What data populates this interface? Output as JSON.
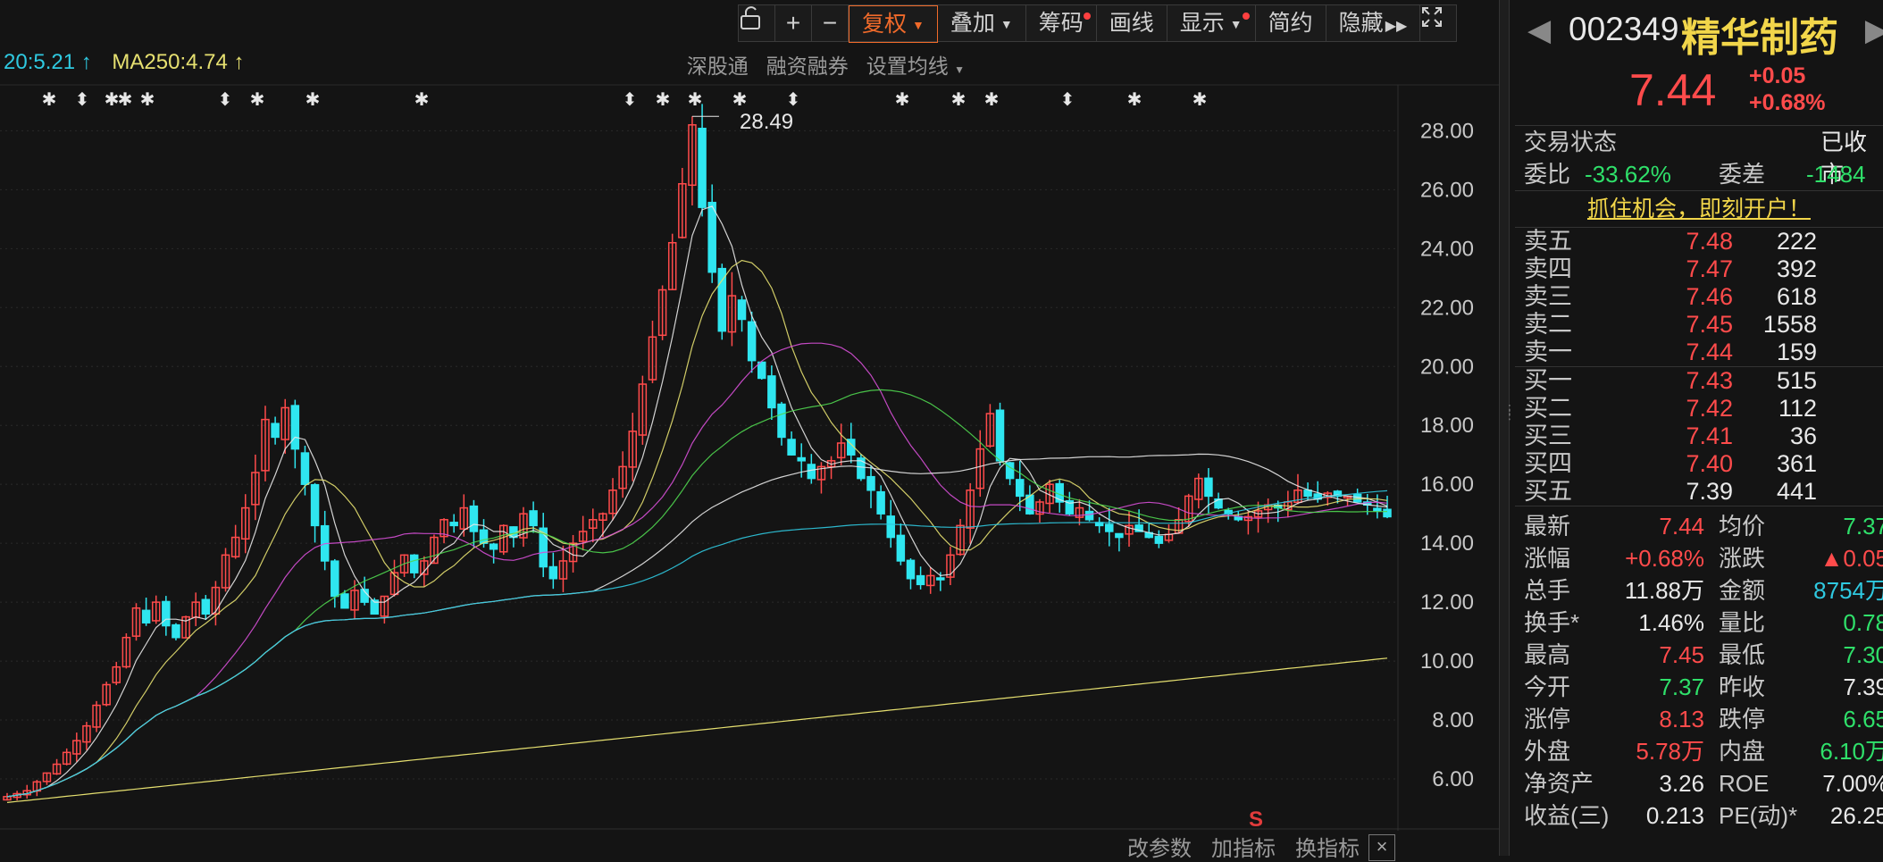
{
  "toolbar": {
    "items": [
      "复权",
      "叠加",
      "筹码",
      "画线",
      "显示",
      "简约",
      "隐藏"
    ]
  },
  "ma_legend": {
    "item_a": "20:5.21 ↑",
    "item_b": "MA250:4.74 ↑"
  },
  "quick_links": [
    "深股通",
    "融资融券",
    "设置均线"
  ],
  "peak_label": "28.49",
  "bottom_bar": [
    "改参数",
    "加指标",
    "换指标"
  ],
  "s_marker": "S",
  "colors": {
    "up": "#ff4b4b",
    "down": "#2fe6f0",
    "accent": "#f06a2a"
  },
  "chart_data": {
    "type": "candlestick",
    "y_ticks": [
      "28.00",
      "26.00",
      "24.00",
      "22.00",
      "20.00",
      "18.00",
      "16.00",
      "14.00",
      "12.00",
      "10.00",
      "8.00",
      "6.00"
    ],
    "ylim": [
      5.0,
      28.8
    ],
    "max_value": 28.49,
    "closes": [
      5.4,
      5.5,
      5.6,
      5.9,
      6.2,
      6.5,
      6.9,
      7.3,
      7.8,
      8.5,
      9.2,
      9.8,
      10.8,
      11.8,
      11.3,
      12.0,
      11.2,
      10.8,
      11.5,
      12.0,
      11.6,
      12.5,
      13.6,
      14.2,
      15.2,
      16.4,
      18.2,
      17.6,
      18.6,
      17.2,
      16.0,
      14.6,
      13.4,
      12.2,
      11.8,
      12.4,
      12.0,
      11.6,
      12.2,
      13.0,
      13.6,
      13.0,
      13.4,
      14.2,
      14.8,
      14.6,
      15.2,
      14.4,
      14.0,
      13.8,
      14.6,
      14.2,
      15.0,
      14.6,
      13.2,
      12.8,
      13.4,
      14.0,
      14.4,
      14.8,
      15.0,
      15.8,
      16.6,
      17.8,
      19.4,
      21.0,
      22.6,
      24.2,
      26.2,
      28.2,
      25.4,
      23.2,
      21.2,
      22.4,
      21.6,
      20.2,
      19.6,
      18.6,
      17.6,
      17.0,
      16.8,
      16.2,
      16.6,
      16.8,
      17.4,
      17.0,
      16.2,
      15.8,
      15.0,
      14.2,
      13.4,
      12.8,
      12.6,
      12.9,
      12.8,
      13.6,
      14.6,
      15.8,
      17.2,
      18.4,
      16.8,
      16.2,
      15.6,
      15.0,
      15.4,
      16.0,
      15.4,
      15.0,
      15.2,
      14.8,
      14.6,
      14.4,
      14.2,
      14.6,
      14.4,
      14.2,
      14.0,
      14.3,
      14.8,
      15.6,
      16.2,
      15.6,
      15.2,
      15.0,
      14.8,
      14.9,
      15.1,
      15.3,
      15.2,
      15.4,
      15.8,
      15.6,
      15.5,
      15.7,
      15.6,
      15.6,
      15.4,
      15.3,
      15.1,
      14.9
    ]
  },
  "stock": {
    "code": "002349",
    "name": "精华制药",
    "price": "7.44",
    "change": "+0.05",
    "change_pct": "+0.68%"
  },
  "status": {
    "label": "交易状态",
    "value": "已收市"
  },
  "ratio": {
    "wb_label": "委比",
    "wb_value": "-33.62%",
    "wc_label": "委差",
    "wc_value": "-1484"
  },
  "promo": "抓住机会，即刻开户！",
  "sells": [
    {
      "label": "卖五",
      "price": "7.48",
      "vol": "222"
    },
    {
      "label": "卖四",
      "price": "7.47",
      "vol": "392"
    },
    {
      "label": "卖三",
      "price": "7.46",
      "vol": "618"
    },
    {
      "label": "卖二",
      "price": "7.45",
      "vol": "1558"
    },
    {
      "label": "卖一",
      "price": "7.44",
      "vol": "159"
    }
  ],
  "buys": [
    {
      "label": "买一",
      "price": "7.43",
      "vol": "515"
    },
    {
      "label": "买二",
      "price": "7.42",
      "vol": "112"
    },
    {
      "label": "买三",
      "price": "7.41",
      "vol": "36"
    },
    {
      "label": "买四",
      "price": "7.40",
      "vol": "361"
    },
    {
      "label": "买五",
      "price": "7.39",
      "vol": "441"
    }
  ],
  "stats": [
    {
      "l1": "最新",
      "v1": "7.44",
      "c1": "red",
      "l2": "均价",
      "v2": "7.37",
      "c2": "green"
    },
    {
      "l1": "涨幅",
      "v1": "+0.68%",
      "c1": "red",
      "l2": "涨跌",
      "v2": "▲0.05",
      "c2": "red"
    },
    {
      "l1": "总手",
      "v1": "11.88万",
      "c1": "white",
      "l2": "金额",
      "v2": "8754万",
      "c2": "cyan"
    },
    {
      "l1": "换手*",
      "v1": "1.46%",
      "c1": "white",
      "l2": "量比",
      "v2": "0.78",
      "c2": "green"
    },
    {
      "l1": "最高",
      "v1": "7.45",
      "c1": "red",
      "l2": "最低",
      "v2": "7.30",
      "c2": "green"
    },
    {
      "l1": "今开",
      "v1": "7.37",
      "c1": "green",
      "l2": "昨收",
      "v2": "7.39",
      "c2": "white"
    },
    {
      "l1": "涨停",
      "v1": "8.13",
      "c1": "red",
      "l2": "跌停",
      "v2": "6.65",
      "c2": "green"
    },
    {
      "l1": "外盘",
      "v1": "5.78万",
      "c1": "red",
      "l2": "内盘",
      "v2": "6.10万",
      "c2": "green"
    },
    {
      "l1": "净资产",
      "v1": "3.26",
      "c1": "white",
      "l2": "ROE",
      "v2": "7.00%",
      "c2": "white"
    },
    {
      "l1": "收益(三)",
      "v1": "0.213",
      "c1": "white",
      "l2": "PE(动)*",
      "v2": "26.25",
      "c2": "white"
    }
  ]
}
